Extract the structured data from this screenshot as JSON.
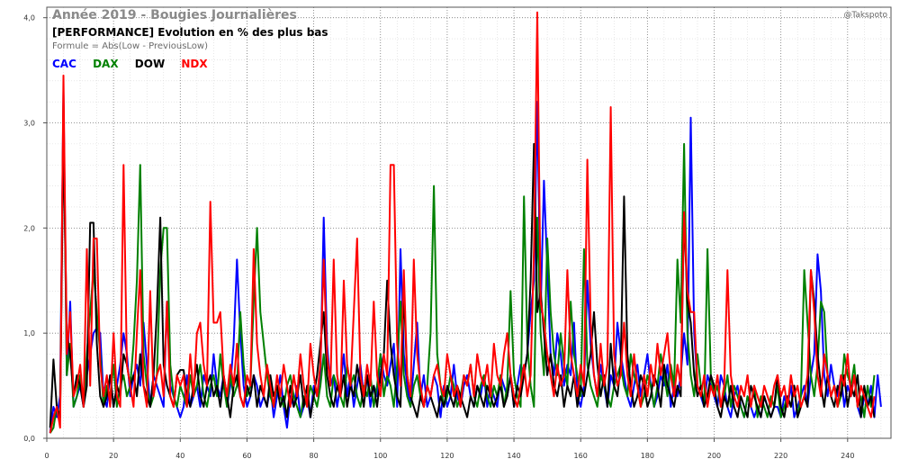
{
  "watermark": "@Takspoto",
  "chart_data": {
    "type": "line",
    "title": "Année 2019 - Bougies Journalières",
    "subtitle": "[PERFORMANCE] Evolution en % des plus bas",
    "formula": "Formule = Abs(Low - PreviousLow)",
    "xlim": [
      0,
      253
    ],
    "ylim": [
      0,
      4.1
    ],
    "xticks": [
      0,
      20,
      40,
      60,
      80,
      100,
      120,
      140,
      160,
      180,
      200,
      220,
      240
    ],
    "yticks": [
      0,
      1,
      2,
      3,
      4
    ],
    "ytick_labels": [
      "0,0",
      "1,0",
      "2,0",
      "3,0",
      "4,0"
    ],
    "grid": true,
    "legend_position": "top-left",
    "colors": {
      "CAC": "#0000ff",
      "DAX": "#008000",
      "DOW": "#000000",
      "NDX": "#ff0000"
    },
    "series": [
      {
        "name": "CAC",
        "values": [
          0.05,
          0.3,
          0.2,
          0.4,
          3.3,
          0.6,
          1.3,
          0.3,
          0.4,
          0.5,
          0.3,
          0.6,
          0.8,
          1.0,
          1.05,
          1.0,
          0.4,
          0.3,
          0.6,
          0.3,
          0.5,
          0.7,
          1.0,
          0.8,
          0.4,
          0.6,
          0.7,
          0.5,
          1.1,
          0.7,
          0.3,
          0.6,
          0.5,
          0.4,
          0.3,
          1.3,
          0.5,
          0.4,
          0.3,
          0.2,
          0.3,
          0.6,
          0.3,
          0.4,
          0.5,
          0.3,
          0.6,
          0.5,
          0.4,
          0.8,
          0.5,
          0.4,
          0.6,
          0.3,
          0.5,
          0.9,
          1.7,
          1.0,
          0.5,
          0.3,
          0.4,
          0.6,
          0.5,
          0.3,
          0.4,
          0.3,
          0.5,
          0.2,
          0.4,
          0.6,
          0.3,
          0.1,
          0.4,
          0.3,
          0.5,
          0.2,
          0.3,
          0.4,
          0.2,
          0.5,
          0.4,
          0.6,
          2.1,
          0.9,
          0.5,
          0.6,
          0.3,
          0.5,
          0.8,
          0.4,
          0.6,
          0.3,
          0.5,
          0.7,
          0.4,
          0.6,
          0.3,
          0.5,
          0.4,
          0.8,
          0.6,
          0.5,
          0.7,
          0.9,
          0.3,
          1.8,
          0.8,
          0.5,
          0.3,
          0.7,
          1.1,
          0.4,
          0.6,
          0.3,
          0.4,
          0.6,
          0.5,
          0.2,
          0.5,
          0.3,
          0.4,
          0.7,
          0.4,
          0.3,
          0.5,
          0.6,
          0.4,
          0.3,
          0.5,
          0.4,
          0.6,
          0.3,
          0.5,
          0.4,
          0.3,
          0.6,
          0.5,
          0.4,
          0.6,
          0.3,
          0.5,
          0.7,
          0.6,
          0.8,
          1.2,
          1.5,
          3.2,
          1.2,
          2.45,
          1.6,
          0.8,
          0.6,
          1.0,
          0.8,
          0.5,
          0.7,
          0.6,
          1.1,
          0.4,
          0.3,
          0.5,
          1.5,
          0.9,
          0.6,
          0.4,
          0.7,
          0.5,
          0.3,
          0.6,
          0.5,
          1.1,
          0.8,
          0.6,
          0.4,
          0.3,
          0.5,
          0.7,
          0.4,
          0.6,
          0.8,
          0.5,
          0.3,
          0.4,
          0.6,
          0.5,
          0.7,
          0.3,
          0.5,
          0.4,
          0.6,
          1.0,
          0.7,
          3.05,
          1.0,
          0.5,
          0.4,
          0.3,
          0.6,
          0.5,
          0.4,
          0.3,
          0.6,
          0.5,
          0.3,
          0.2,
          0.4,
          0.5,
          0.3,
          0.2,
          0.4,
          0.3,
          0.2,
          0.3,
          0.2,
          0.4,
          0.3,
          0.2,
          0.3,
          0.3,
          0.2,
          0.4,
          0.3,
          0.5,
          0.2,
          0.3,
          0.4,
          0.5,
          0.3,
          0.6,
          0.8,
          1.75,
          1.4,
          0.6,
          0.4,
          0.7,
          0.5,
          0.4,
          0.6,
          0.3,
          0.5,
          0.4,
          0.6,
          0.3,
          0.2,
          0.4,
          0.3,
          0.5,
          0.2,
          0.6,
          0.3
        ],
        "color": "#0000ff"
      },
      {
        "name": "DAX",
        "values": [
          0.05,
          0.1,
          0.3,
          0.2,
          3.2,
          0.6,
          0.9,
          0.3,
          0.4,
          0.6,
          0.3,
          0.8,
          1.2,
          1.6,
          1.2,
          0.8,
          0.3,
          0.5,
          0.4,
          0.7,
          0.3,
          0.5,
          0.6,
          0.4,
          0.5,
          0.9,
          1.5,
          2.6,
          0.8,
          0.5,
          0.3,
          0.4,
          0.6,
          1.6,
          2.0,
          2.0,
          0.7,
          0.4,
          0.3,
          0.5,
          0.4,
          0.3,
          0.6,
          0.4,
          0.5,
          0.7,
          0.4,
          0.3,
          0.5,
          0.6,
          0.4,
          0.8,
          0.5,
          0.3,
          0.6,
          0.4,
          0.5,
          1.2,
          0.7,
          0.4,
          0.5,
          1.3,
          2.0,
          1.2,
          0.9,
          0.6,
          0.4,
          0.3,
          0.5,
          0.4,
          0.3,
          0.5,
          0.6,
          0.4,
          0.3,
          0.2,
          0.4,
          0.3,
          0.5,
          0.4,
          0.3,
          0.5,
          0.8,
          0.4,
          0.3,
          0.6,
          0.5,
          0.4,
          0.3,
          0.7,
          0.5,
          0.6,
          0.4,
          0.3,
          0.5,
          0.4,
          0.6,
          0.3,
          0.5,
          0.8,
          0.4,
          0.6,
          0.5,
          0.3,
          0.7,
          1.3,
          0.6,
          0.4,
          0.3,
          0.5,
          0.6,
          0.4,
          0.3,
          0.5,
          1.0,
          2.4,
          0.8,
          0.5,
          0.3,
          0.4,
          0.6,
          0.5,
          0.3,
          0.4,
          0.6,
          0.5,
          0.7,
          0.4,
          0.3,
          0.5,
          0.6,
          0.4,
          0.3,
          0.5,
          0.4,
          0.6,
          0.3,
          0.5,
          1.4,
          0.6,
          0.4,
          0.3,
          2.3,
          0.9,
          0.5,
          0.3,
          2.1,
          1.0,
          0.6,
          1.9,
          1.2,
          0.8,
          0.6,
          1.0,
          0.7,
          0.5,
          1.3,
          0.8,
          0.6,
          0.4,
          1.8,
          0.7,
          0.5,
          0.4,
          0.3,
          0.6,
          0.5,
          0.4,
          0.3,
          0.5,
          0.6,
          0.7,
          0.5,
          0.4,
          0.8,
          0.6,
          0.5,
          0.3,
          0.4,
          0.6,
          0.5,
          0.3,
          0.5,
          0.8,
          0.6,
          0.4,
          0.7,
          0.5,
          1.7,
          1.1,
          2.8,
          1.0,
          0.6,
          0.4,
          0.8,
          0.5,
          0.3,
          1.8,
          0.6,
          0.4,
          0.5,
          0.3,
          0.4,
          0.6,
          0.3,
          0.5,
          0.4,
          0.3,
          0.2,
          0.4,
          0.3,
          0.5,
          0.2,
          0.4,
          0.3,
          0.2,
          0.4,
          0.3,
          0.5,
          0.2,
          0.3,
          0.4,
          0.3,
          0.5,
          0.2,
          0.4,
          1.6,
          1.1,
          0.6,
          0.4,
          0.7,
          1.3,
          1.2,
          0.6,
          0.4,
          0.5,
          0.3,
          0.4,
          0.8,
          0.6,
          0.5,
          0.7,
          0.3,
          0.4,
          0.2,
          0.5,
          0.3,
          0.6
        ],
        "color": "#008000"
      },
      {
        "name": "DOW",
        "values": [
          0.1,
          0.75,
          0.3,
          0.2,
          2.9,
          1.0,
          0.8,
          0.4,
          0.6,
          0.5,
          0.3,
          0.5,
          2.05,
          2.05,
          0.9,
          0.4,
          0.3,
          0.4,
          0.6,
          0.3,
          0.5,
          0.4,
          0.8,
          0.7,
          0.5,
          0.6,
          0.4,
          0.8,
          0.5,
          0.4,
          0.3,
          0.6,
          1.2,
          2.1,
          0.7,
          0.5,
          0.4,
          0.3,
          0.6,
          0.65,
          0.65,
          0.4,
          0.3,
          0.5,
          0.7,
          0.4,
          0.3,
          0.5,
          0.6,
          0.4,
          0.5,
          0.3,
          0.6,
          0.4,
          0.2,
          0.5,
          0.6,
          0.4,
          0.3,
          0.5,
          0.4,
          0.6,
          0.3,
          0.5,
          0.4,
          0.3,
          0.6,
          0.4,
          0.5,
          0.3,
          0.4,
          0.2,
          0.5,
          0.3,
          0.4,
          0.6,
          0.3,
          0.5,
          0.2,
          0.4,
          0.6,
          0.9,
          1.2,
          0.6,
          0.4,
          0.3,
          0.5,
          0.4,
          0.6,
          0.3,
          0.5,
          0.4,
          0.7,
          0.5,
          0.3,
          0.6,
          0.4,
          0.5,
          0.3,
          0.6,
          0.8,
          1.5,
          0.9,
          0.6,
          0.4,
          0.3,
          1.4,
          0.6,
          0.4,
          0.3,
          0.2,
          0.4,
          0.3,
          0.5,
          0.4,
          0.3,
          0.2,
          0.4,
          0.3,
          0.5,
          0.4,
          0.3,
          0.5,
          0.4,
          0.3,
          0.2,
          0.4,
          0.3,
          0.5,
          0.4,
          0.3,
          0.5,
          0.4,
          0.3,
          0.4,
          0.5,
          0.3,
          0.4,
          0.6,
          0.3,
          0.5,
          0.4,
          0.6,
          0.8,
          1.5,
          2.8,
          1.2,
          1.4,
          1.0,
          0.6,
          0.8,
          0.5,
          0.4,
          0.6,
          0.3,
          0.5,
          0.4,
          0.6,
          0.3,
          0.5,
          0.4,
          0.6,
          0.8,
          1.2,
          0.7,
          0.4,
          0.6,
          0.3,
          0.9,
          0.5,
          0.4,
          0.7,
          2.3,
          0.8,
          0.5,
          0.3,
          0.4,
          0.6,
          0.5,
          0.3,
          0.4,
          0.6,
          0.5,
          0.3,
          0.7,
          0.5,
          0.4,
          0.3,
          0.5,
          0.4,
          2.15,
          1.3,
          1.1,
          0.6,
          0.4,
          0.5,
          0.3,
          0.4,
          0.6,
          0.5,
          0.3,
          0.2,
          0.4,
          0.3,
          0.5,
          0.3,
          0.2,
          0.4,
          0.3,
          0.2,
          0.5,
          0.4,
          0.3,
          0.2,
          0.4,
          0.3,
          0.2,
          0.3,
          0.6,
          0.3,
          0.2,
          0.4,
          0.3,
          0.5,
          0.2,
          0.3,
          0.4,
          0.3,
          1.6,
          1.3,
          0.8,
          0.5,
          0.3,
          0.6,
          0.4,
          0.3,
          0.5,
          0.4,
          0.6,
          0.3,
          0.5,
          0.4,
          0.6,
          0.2,
          0.5,
          0.3,
          0.4,
          0.2
        ],
        "color": "#000000"
      },
      {
        "name": "NDX",
        "values": [
          0.05,
          0.2,
          0.3,
          0.1,
          3.45,
          0.8,
          1.2,
          0.4,
          0.5,
          0.7,
          0.3,
          1.8,
          0.5,
          1.9,
          1.9,
          0.7,
          0.4,
          0.6,
          0.3,
          1.0,
          0.4,
          0.3,
          2.6,
          0.7,
          0.5,
          0.3,
          1.0,
          1.6,
          0.5,
          0.3,
          1.4,
          0.4,
          0.6,
          0.7,
          0.4,
          1.3,
          0.4,
          0.3,
          0.6,
          0.5,
          0.6,
          0.3,
          0.8,
          0.4,
          1.0,
          1.1,
          0.7,
          0.5,
          2.25,
          1.1,
          1.1,
          1.2,
          0.6,
          0.4,
          0.7,
          0.5,
          0.9,
          0.4,
          0.3,
          0.6,
          0.5,
          1.8,
          0.9,
          0.6,
          0.4,
          0.7,
          0.5,
          0.3,
          0.6,
          0.4,
          0.7,
          0.5,
          0.3,
          0.6,
          0.4,
          0.8,
          0.5,
          0.3,
          0.9,
          0.6,
          0.4,
          0.7,
          1.7,
          0.8,
          0.5,
          1.7,
          0.6,
          0.4,
          1.5,
          0.7,
          0.5,
          1.2,
          1.9,
          0.6,
          0.4,
          0.7,
          0.5,
          1.3,
          0.6,
          0.4,
          0.8,
          0.6,
          2.6,
          2.6,
          0.9,
          0.5,
          1.6,
          0.6,
          0.4,
          1.7,
          0.8,
          0.5,
          0.3,
          0.5,
          0.4,
          0.6,
          0.7,
          0.5,
          0.4,
          0.8,
          0.6,
          0.4,
          0.5,
          0.3,
          0.6,
          0.5,
          0.7,
          0.4,
          0.8,
          0.6,
          0.5,
          0.7,
          0.4,
          0.9,
          0.6,
          0.5,
          0.8,
          1.0,
          0.6,
          0.4,
          0.3,
          0.5,
          0.7,
          0.4,
          0.6,
          1.8,
          4.05,
          1.3,
          1.1,
          0.8,
          0.6,
          0.4,
          0.7,
          0.5,
          0.6,
          1.6,
          0.8,
          0.6,
          0.4,
          0.7,
          0.5,
          2.65,
          1.1,
          0.6,
          0.4,
          0.9,
          0.5,
          0.7,
          3.15,
          0.8,
          0.5,
          0.6,
          1.1,
          0.6,
          0.4,
          0.8,
          0.5,
          0.3,
          0.6,
          0.4,
          0.7,
          0.5,
          0.9,
          0.6,
          0.8,
          1.0,
          0.6,
          0.4,
          0.7,
          0.5,
          2.15,
          1.4,
          1.2,
          1.2,
          0.5,
          0.4,
          0.6,
          0.3,
          0.5,
          0.4,
          0.6,
          0.3,
          0.5,
          1.6,
          0.6,
          0.4,
          0.3,
          0.5,
          0.4,
          0.6,
          0.3,
          0.5,
          0.4,
          0.3,
          0.5,
          0.4,
          0.3,
          0.5,
          0.6,
          0.4,
          0.5,
          0.3,
          0.6,
          0.4,
          0.5,
          0.3,
          0.4,
          0.6,
          1.6,
          1.2,
          0.6,
          0.4,
          0.8,
          0.6,
          0.4,
          0.5,
          0.3,
          0.6,
          0.5,
          0.8,
          0.4,
          0.6,
          0.3,
          0.5,
          0.4,
          0.3,
          0.2,
          0.4
        ],
        "color": "#ff0000"
      }
    ]
  }
}
